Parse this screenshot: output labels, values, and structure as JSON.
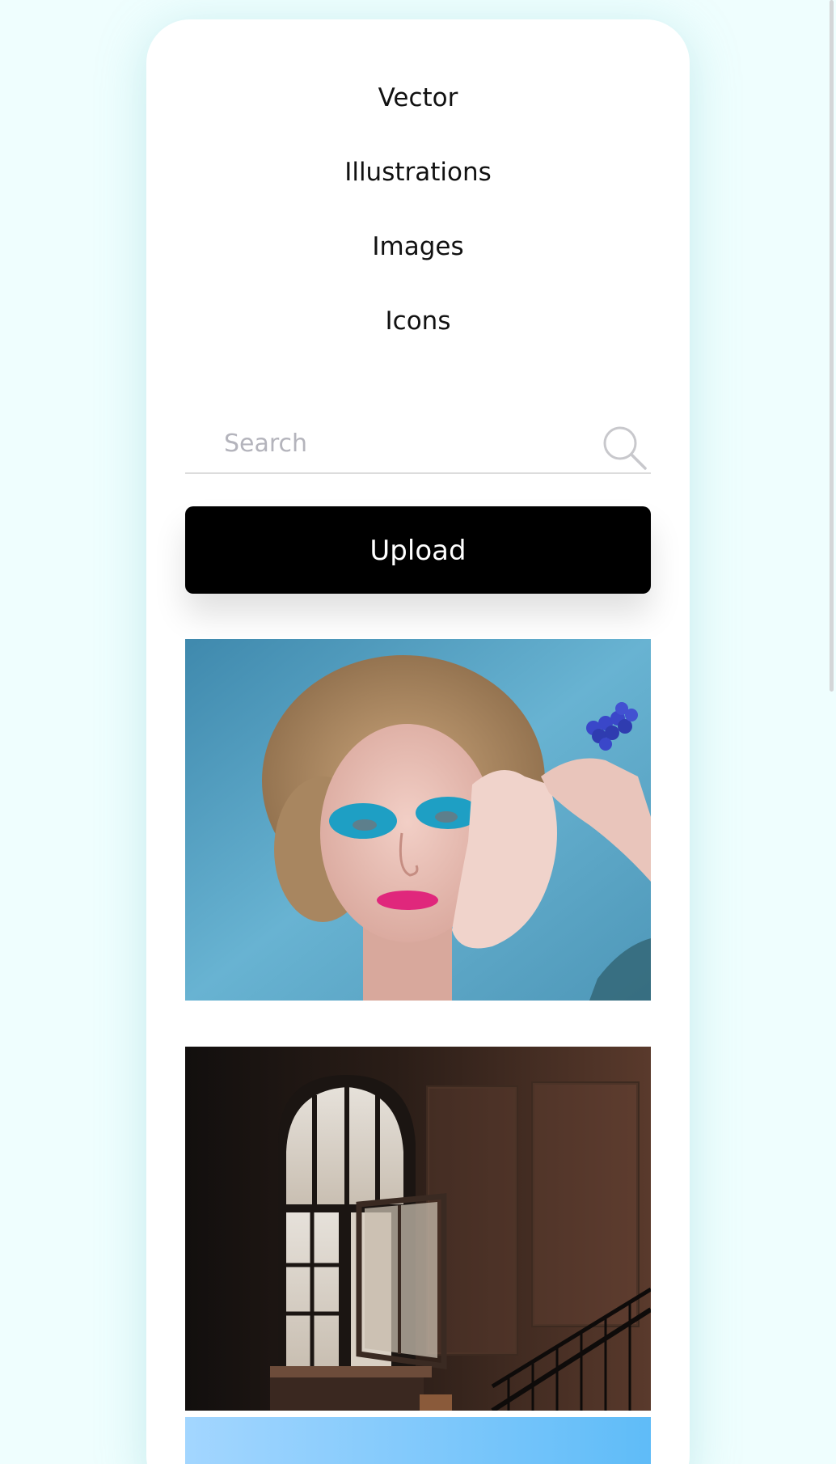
{
  "nav": {
    "items": [
      {
        "label": "Vector"
      },
      {
        "label": "Illustrations"
      },
      {
        "label": "Images"
      },
      {
        "label": "Icons"
      }
    ]
  },
  "search": {
    "placeholder": "Search",
    "icon": "search-icon"
  },
  "upload": {
    "label": "Upload"
  },
  "gallery": {
    "images": [
      {
        "subject": "portrait-blue-eyeshadow"
      },
      {
        "subject": "dark-room-arched-window"
      },
      {
        "subject": "sky"
      }
    ]
  },
  "colors": {
    "background": "#effefe",
    "card": "#ffffff",
    "button": "#000000",
    "button_text": "#ffffff"
  }
}
